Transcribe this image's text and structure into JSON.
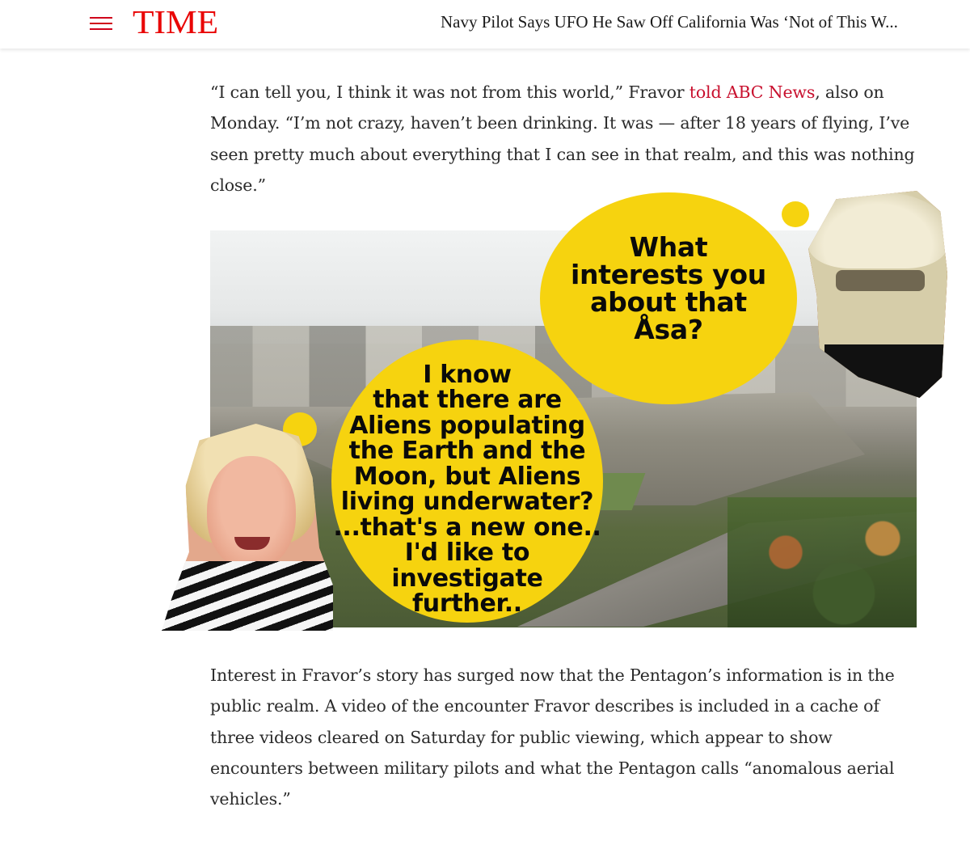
{
  "header": {
    "logo": "TIME",
    "headline": "Navy Pilot Says UFO He Saw Off California Was ‘Not of This W..."
  },
  "article": {
    "para1": {
      "before_link": "“I can tell you, I think it was not from this world,” Fravor ",
      "link": "told ABC News",
      "after_link": ", also on Monday. “I’m not crazy, haven’t been drinking. It was — after 18 years of flying, I’ve seen pretty much about everything that I can see in that realm, and this was nothing close.”"
    },
    "para2": "Interest in Fravor’s story has surged now that the Pentagon’s information is in the public realm. A video of the encounter Fravor describes is included in a cache of three videos cleared on Saturday for public viewing, which appear to show encounters between military pilots and what the Pentagon calls “anomalous aerial vehicles.”"
  },
  "image": {
    "bubble_top": "What\ninterests you\nabout that\nÅsa?",
    "bubble_left": "I know\nthat there are\nAliens populating\nthe Earth and the\nMoon, but Aliens\nliving underwater?\n...that's a new one..\nI'd like to\ninvestigate\nfurther.."
  },
  "colors": {
    "brand": "#e90606",
    "link": "#c8102e",
    "bubble": "#f6d30f"
  },
  "icons": {
    "menu": "hamburger-menu-icon"
  }
}
